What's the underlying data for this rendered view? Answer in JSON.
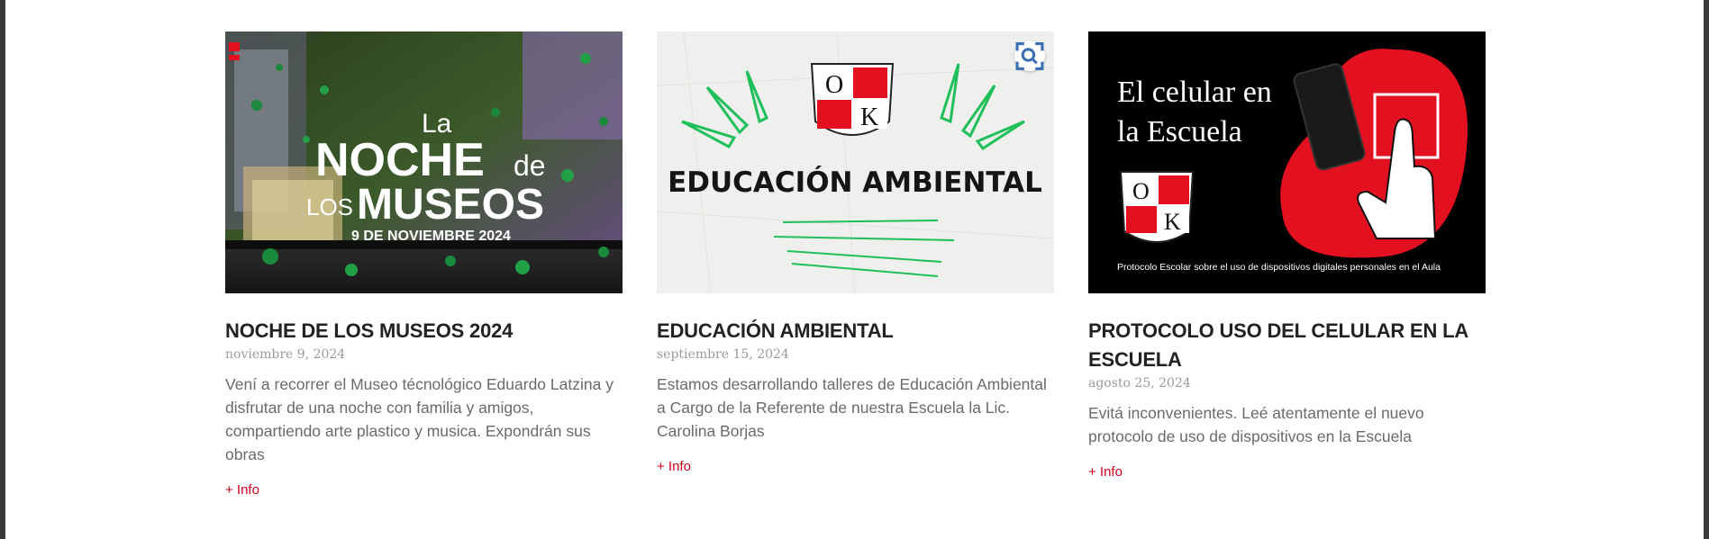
{
  "colors": {
    "title": "#222222",
    "date": "#9a9a9a",
    "excerpt": "#6a6a6a",
    "link": "#d0021b",
    "brand_red": "#e3101f"
  },
  "posts": [
    {
      "image": {
        "alt_icon": "museum-night-photo",
        "line1": "La",
        "line2a": "NOCHE",
        "line2b": "de",
        "line3a": "LOS",
        "line3b": "MUSEOS",
        "line4": "9 DE NOVIEMBRE 2024"
      },
      "title": "NOCHE DE LOS MUSEOS 2024",
      "date": "noviembre 9, 2024",
      "excerpt": "Vení a recorrer el Museo técnológico Eduardo Latzina y disfrutar de una noche con familia y amigos, compartiendo arte plastico y musica. Expondrán sus obras",
      "link": "+ Info"
    },
    {
      "image": {
        "logo_top": "O",
        "logo_bottom": "K",
        "heading": "EDUCACIÓN AMBIENTAL",
        "zoom_icon": "zoom-scan-icon"
      },
      "title": "EDUCACIÓN AMBIENTAL",
      "date": "septiembre 15, 2024",
      "excerpt": "Estamos desarrollando talleres de Educación Ambiental a Cargo de la Referente de nuestra Escuela la Lic. Carolina Borjas",
      "link": "+ Info"
    },
    {
      "image": {
        "line1": "El celular en",
        "line2": "la Escuela",
        "logo_top": "O",
        "logo_bottom": "K",
        "caption": "Protocolo Escolar  sobre el uso de dispositivos digitales personales en el Aula"
      },
      "title": "PROTOCOLO USO DEL CELULAR EN LA ESCUELA",
      "date": "agosto 25, 2024",
      "excerpt": "Evitá inconvenientes. Leé atentamente el nuevo protocolo de uso de dispositivos en la Escuela",
      "link": "+ Info"
    }
  ]
}
